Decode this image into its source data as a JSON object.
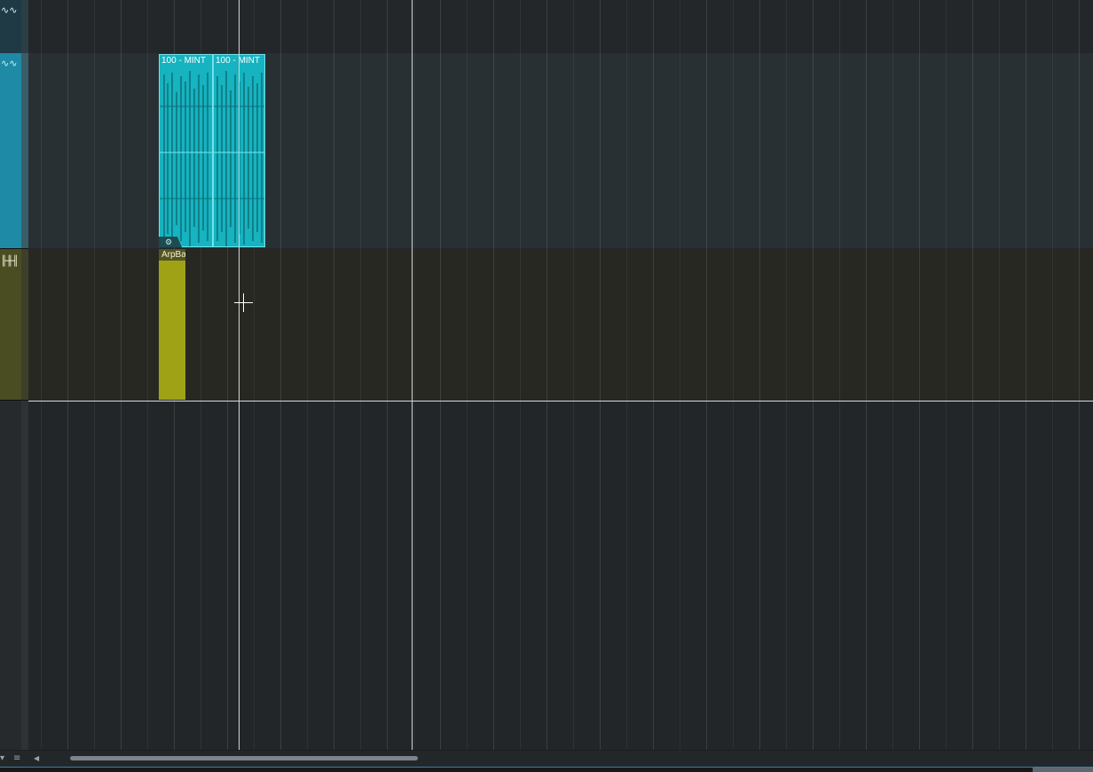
{
  "window": {
    "title": ""
  },
  "tracks": [
    {
      "kind": "audio",
      "icon": "waveform-icon",
      "icon_glyph": "∿∿",
      "color": "#1e8aa6"
    },
    {
      "kind": "audio",
      "icon": "waveform-icon",
      "icon_glyph": "∿∿",
      "color": "#1e8aa6"
    },
    {
      "kind": "instrument",
      "icon": "keyboard-icon",
      "icon_glyph": "╟╫╢",
      "color": "#4a4d22"
    }
  ],
  "clips": {
    "audio_1_label": "100 - MINT",
    "audio_2_label": "100 - MINT",
    "instrument_label": "ArpBa",
    "gear_glyph": "⚙"
  },
  "colors": {
    "audio_clip": "#16b3c0",
    "instrument_clip": "#9fa215",
    "background": "#232729"
  },
  "scrollbar": {
    "menu_glyph": "≡",
    "left_arrow": "◀",
    "down_arrow": "▾"
  }
}
